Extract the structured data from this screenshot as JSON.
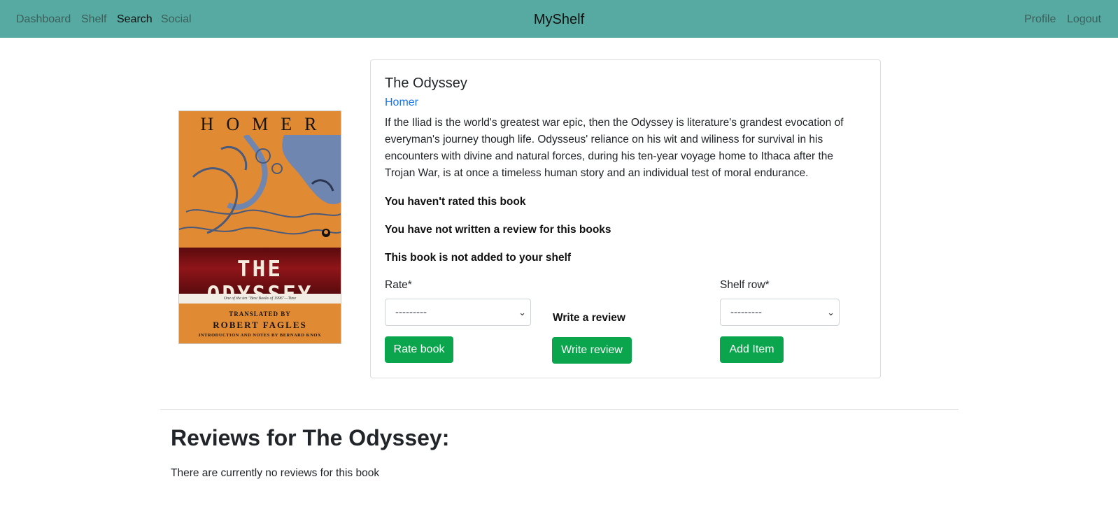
{
  "nav": {
    "brand": "MyShelf",
    "left": [
      "Dashboard",
      "Shelf",
      "Search",
      "Social"
    ],
    "right": [
      "Profile",
      "Logout"
    ],
    "active": "Search"
  },
  "book": {
    "title": "The Odyssey",
    "author": "Homer",
    "description": "If the Iliad is the world's greatest war epic, then the Odyssey is literature's grandest evocation of everyman's journey though life. Odysseus' reliance on his wit and wiliness for survival in his encounters with divine and natural forces, during his ten-year voyage home to Ithaca after the Trojan War, is at once a timeless human story and an individual test of moral endurance.",
    "cover": {
      "author": "HOMER",
      "title": "THE ODYSSEY",
      "quote": "One of the ten \"Best Books of 1996\"—Time",
      "translated_by": "TRANSLATED BY",
      "translator": "ROBERT FAGLES",
      "intro": "INTRODUCTION AND NOTES BY BERNARD KNOX"
    }
  },
  "status": {
    "rating": "You haven't rated this book",
    "review": "You have not written a review for this books",
    "shelf": "This book is not added to your shelf"
  },
  "actions": {
    "rate_label": "Rate*",
    "rate_value": "---------",
    "rate_button": "Rate book",
    "review_label": "Write a review",
    "review_button": "Write review",
    "shelf_label": "Shelf row*",
    "shelf_value": "---------",
    "shelf_button": "Add Item"
  },
  "reviews": {
    "heading": "Reviews for The Odyssey:",
    "empty": "There are currently no reviews for this book"
  },
  "colors": {
    "navbar": "#57aaa1",
    "button": "#0aa54c",
    "link": "#1a73e8"
  }
}
